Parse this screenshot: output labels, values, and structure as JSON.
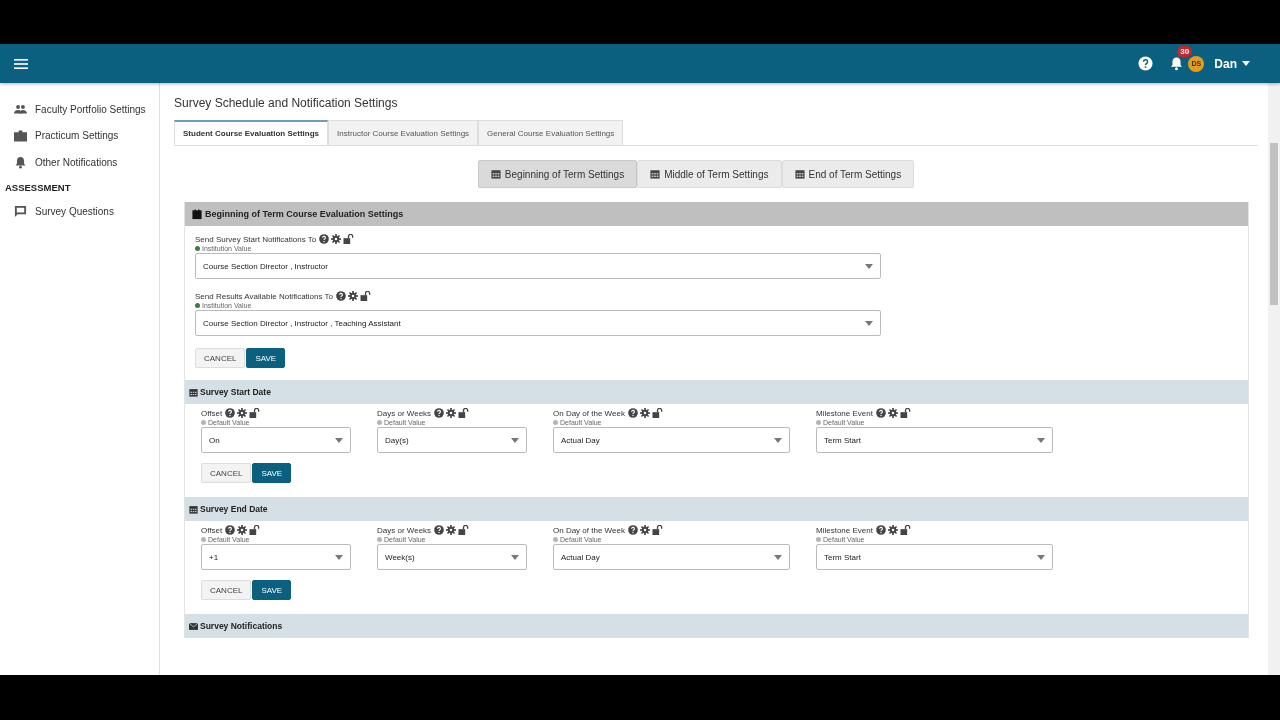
{
  "header": {
    "notification_count": "30",
    "avatar_initials": "DS",
    "user_name": "Dan"
  },
  "sidebar": {
    "entries": [
      {
        "kind": "item",
        "label": "Faculty Portfolio Settings"
      },
      {
        "kind": "item",
        "label": "Practicum Settings"
      },
      {
        "kind": "item",
        "label": "Other Notifications"
      },
      {
        "kind": "heading",
        "label": "ASSESSMENT"
      },
      {
        "kind": "item",
        "label": "Survey Questions"
      }
    ]
  },
  "page_title": "Survey Schedule and Notification Settings",
  "tabs": [
    {
      "label": "Student Course Evaluation Settings",
      "selected": true
    },
    {
      "label": "Instructor Course Evaluation Settings",
      "selected": false
    },
    {
      "label": "General Course Evaluation Settings",
      "selected": false
    }
  ],
  "term_buttons": [
    {
      "label": "Beginning of Term Settings",
      "selected": true
    },
    {
      "label": "Middle of Term Settings",
      "selected": false
    },
    {
      "label": "End of Term Settings",
      "selected": false
    }
  ],
  "panel": {
    "title": "Beginning of Term Course Evaluation Settings",
    "fields": [
      {
        "label": "Send Survey Start Notifications To",
        "hint": "Institution Value",
        "color": "#3a7d44",
        "value": "Course Section Director , Instructor"
      },
      {
        "label": "Send Results Available Notifications To",
        "hint": "Institution Value",
        "color": "#3a7d44",
        "value": "Course Section Director , Instructor , Teaching Assistant"
      }
    ],
    "buttons": [
      "CANCEL",
      "SAVE"
    ]
  },
  "sections": [
    {
      "kind": "calendar",
      "title": "Survey Start Date",
      "fields": [
        {
          "label": "Offset",
          "hint": "Default Value",
          "color": "#b5b5b5",
          "value": "On"
        },
        {
          "label": "Days or Weeks",
          "hint": "Default Value",
          "color": "#b5b5b5",
          "value": "Day(s)"
        },
        {
          "label": "On Day of the Week",
          "hint": "Default Value",
          "color": "#b5b5b5",
          "value": "Actual Day"
        },
        {
          "label": "Milestone Event",
          "hint": "Default Value",
          "color": "#b5b5b5",
          "value": "Term Start"
        }
      ],
      "buttons": [
        "CANCEL",
        "SAVE"
      ]
    },
    {
      "kind": "calendar",
      "title": "Survey End Date",
      "fields": [
        {
          "label": "Offset",
          "hint": "Default Value",
          "color": "#b5b5b5",
          "value": "+1"
        },
        {
          "label": "Days or Weeks",
          "hint": "Default Value",
          "color": "#b5b5b5",
          "value": "Week(s)"
        },
        {
          "label": "On Day of the Week",
          "hint": "Default Value",
          "color": "#b5b5b5",
          "value": "Actual Day"
        },
        {
          "label": "Milestone Event",
          "hint": "Default Value",
          "color": "#b5b5b5",
          "value": "Term Start"
        }
      ],
      "buttons": [
        "CANCEL",
        "SAVE"
      ]
    },
    {
      "kind": "envelope",
      "title": "Survey Notifications"
    }
  ]
}
